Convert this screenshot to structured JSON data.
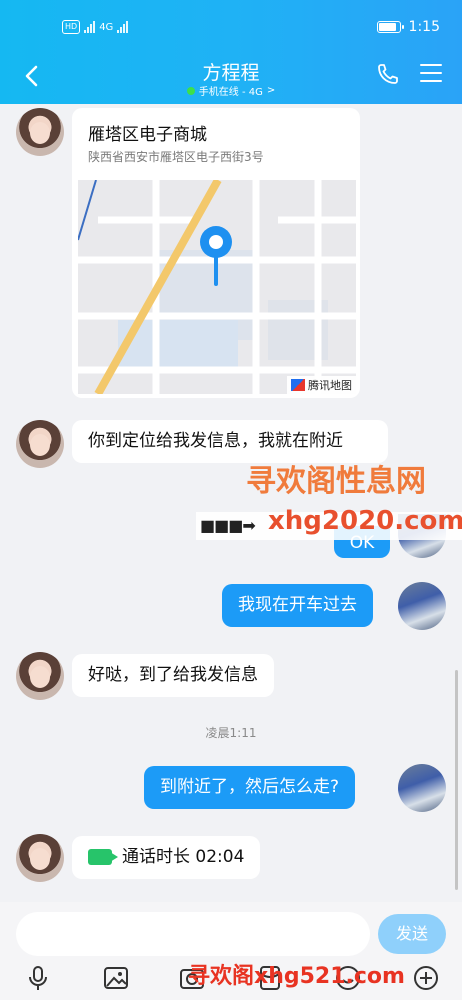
{
  "status_bar": {
    "network": "4G",
    "time": "1:15",
    "battery_level": 0.8
  },
  "header": {
    "title": "方程程",
    "status": "手机在线 - 4G",
    "status_suffix": ">"
  },
  "location_card": {
    "name": "雁塔区电子商城",
    "address": "陕西省西安市雁塔区电子西街3号",
    "map_brand": "腾讯地图"
  },
  "messages": {
    "m2": "你到定位给我发信息，我就在附近",
    "m3": "OK",
    "m4": "我现在开车过去",
    "m5": "好哒，到了给我发信息",
    "time_label": "凌晨1:11",
    "m6": "到附近了，然后怎么走?",
    "m7": "通话时长 02:04"
  },
  "watermarks": {
    "wm1": "寻欢阁性息网",
    "wm2": "xhg2020.com",
    "wm3": "寻欢阁xhg521.com"
  },
  "input": {
    "value": "",
    "placeholder": "",
    "send_label": "发送"
  },
  "toolbar_icons": [
    "microphone-icon",
    "image-icon",
    "camera-icon",
    "red-packet-icon",
    "emoji-icon",
    "plus-icon"
  ],
  "colors": {
    "header_start": "#15b8f2",
    "header_end": "#2aa3f7",
    "bubble_self": "#1c9bf7",
    "bubble_other": "#ffffff",
    "send_button": "#8fd0fb",
    "online": "#3de04a",
    "call_icon": "#27c46a"
  }
}
